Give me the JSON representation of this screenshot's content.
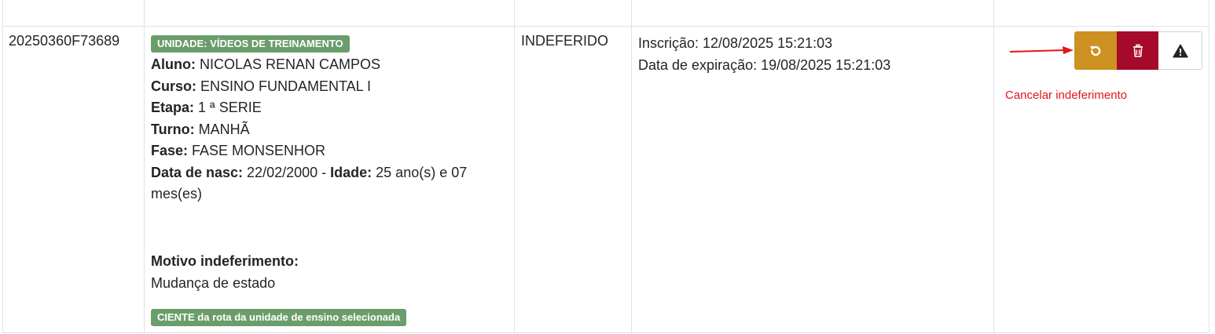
{
  "row": {
    "code": "20250360F73689",
    "unit_badge": "UNIDADE: VÍDEOS DE TREINAMENTO",
    "aluno_label": "Aluno:",
    "aluno_value": " NICOLAS RENAN CAMPOS",
    "curso_label": "Curso:",
    "curso_value": " ENSINO FUNDAMENTAL I",
    "etapa_label": "Etapa:",
    "etapa_value": " 1 ª SERIE",
    "turno_label": "Turno:",
    "turno_value": " MANHÃ",
    "fase_label": "Fase:",
    "fase_value": " FASE MONSENHOR",
    "nasc_label": "Data de nasc:",
    "nasc_value": " 22/02/2000 - ",
    "idade_label": "Idade:",
    "idade_value": " 25 ano(s) e 07 mes(es)",
    "motivo_label": "Motivo indeferimento:",
    "motivo_value": "Mudança de estado",
    "ciente_badge": "CIENTE da rota da unidade de ensino selecionada",
    "status": "INDEFERIDO",
    "inscricao": "Inscrição: 12/08/2025 15:21:03",
    "expiracao": "Data de expiração: 19/08/2025 15:21:03"
  },
  "actions": {
    "undo_icon": "undo-icon",
    "delete_icon": "trash-icon",
    "warn_icon": "warning-icon",
    "annotation": "Cancelar indeferimento",
    "colors": {
      "undo": "#cc9121",
      "delete": "#a50a2a",
      "annotation": "#e3141c",
      "badge": "#6b9d6b"
    }
  }
}
